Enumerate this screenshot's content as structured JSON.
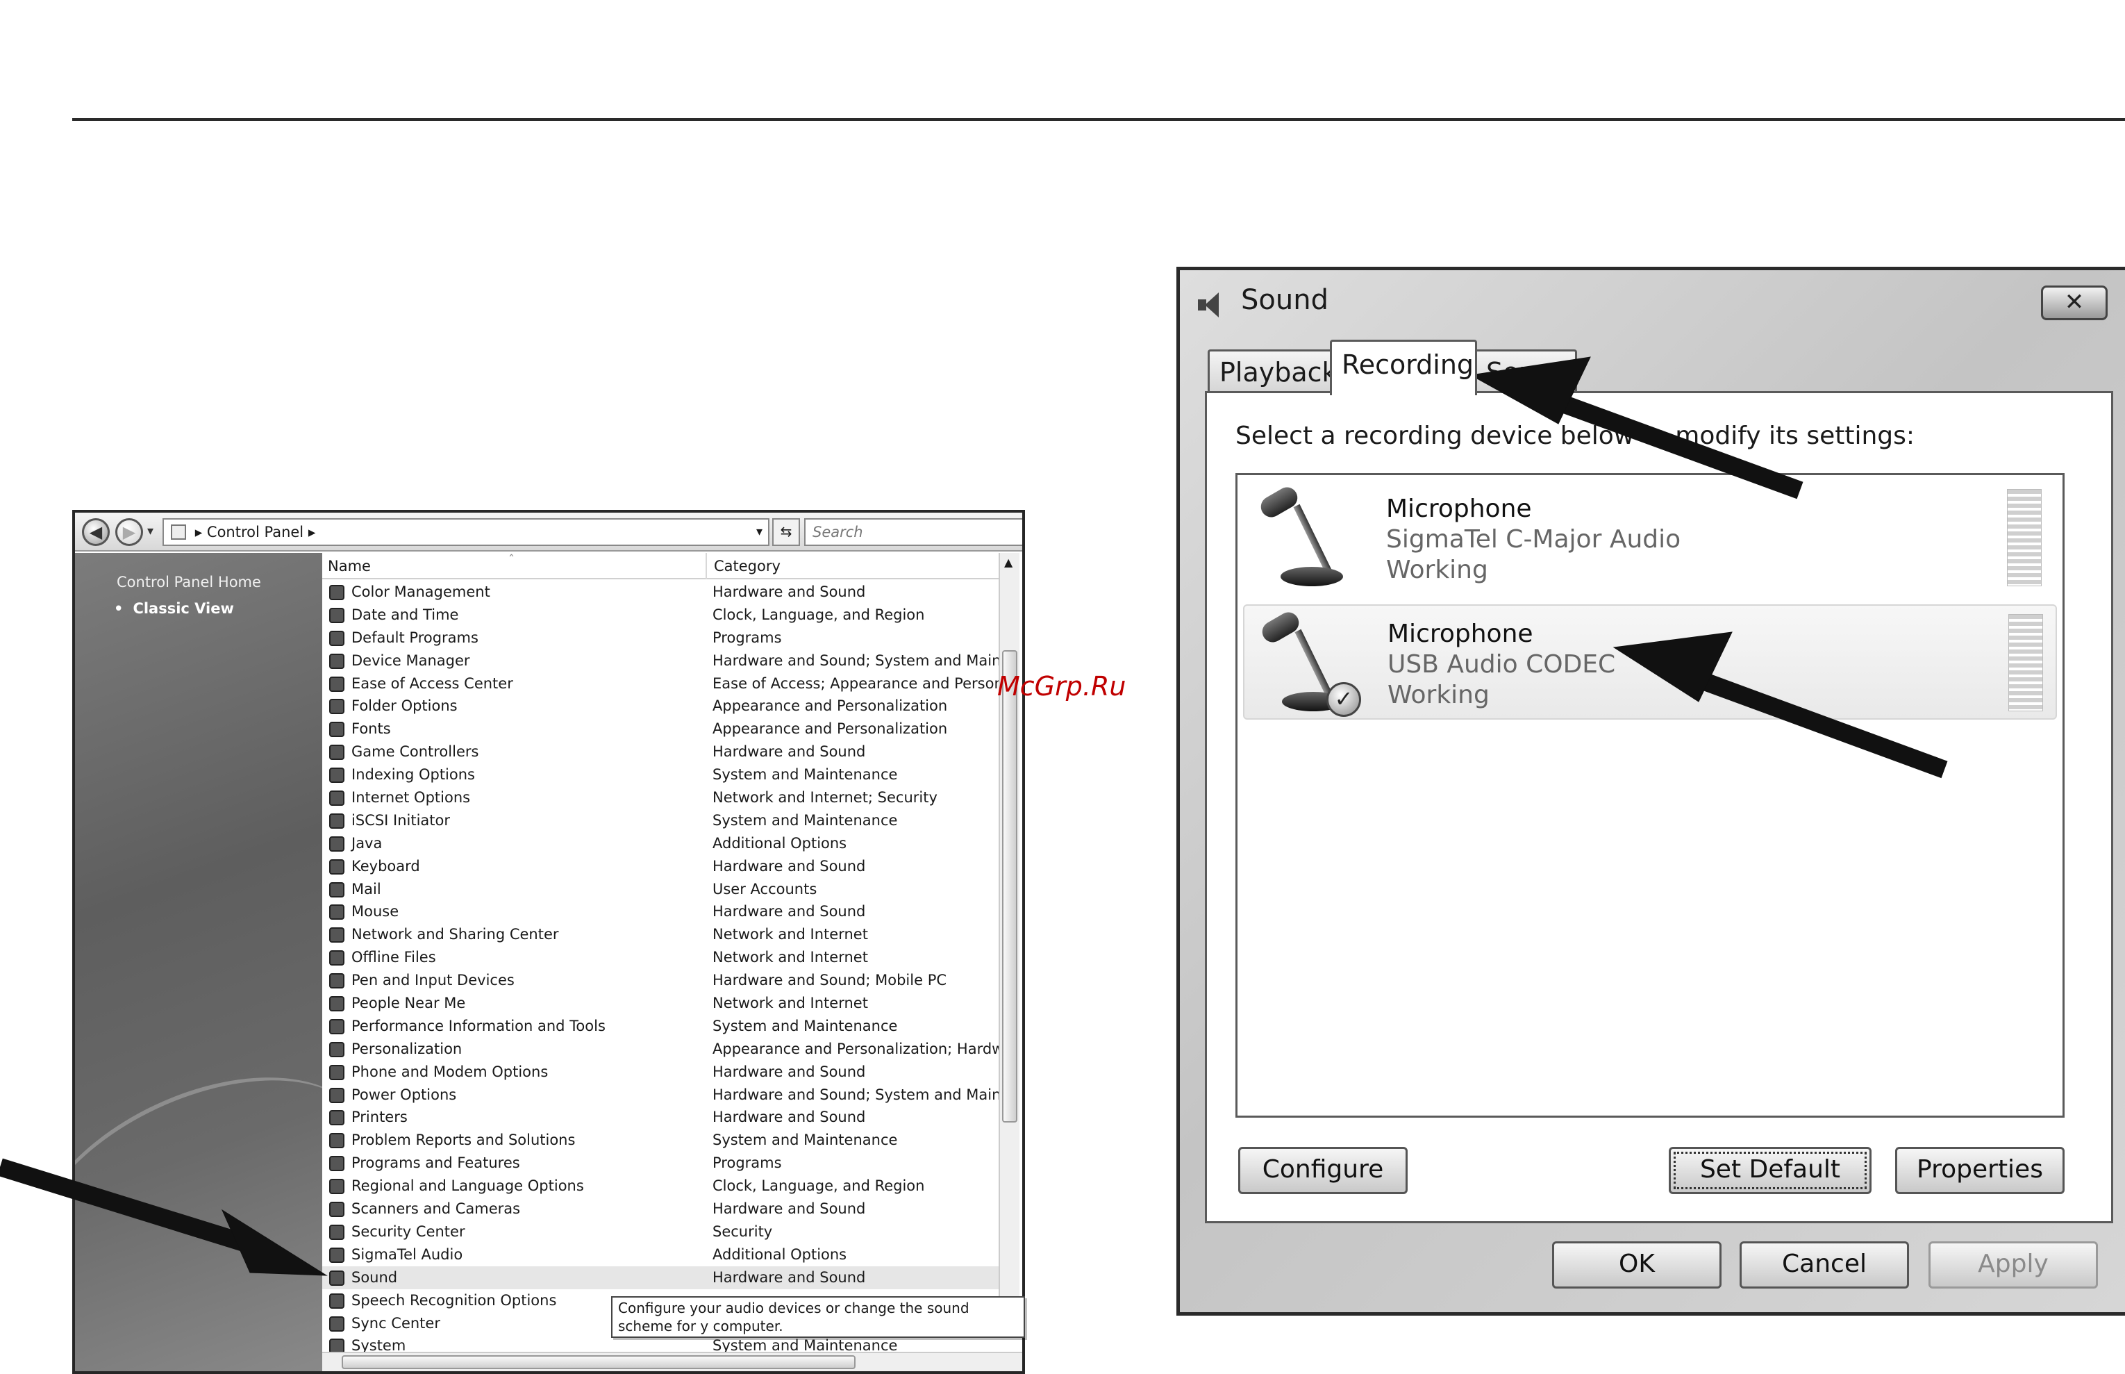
{
  "control_panel": {
    "address": "Control Panel",
    "search_placeholder": "Search",
    "sidebar": {
      "home": "Control Panel Home",
      "classic": "Classic View"
    },
    "columns": {
      "name": "Name",
      "category": "Category"
    },
    "items": [
      {
        "name": "Color Management",
        "category": "Hardware and Sound"
      },
      {
        "name": "Date and Time",
        "category": "Clock, Language, and Region"
      },
      {
        "name": "Default Programs",
        "category": "Programs"
      },
      {
        "name": "Device Manager",
        "category": "Hardware and Sound; System and Maintenanc"
      },
      {
        "name": "Ease of Access Center",
        "category": "Ease of Access; Appearance and Personalizatio"
      },
      {
        "name": "Folder Options",
        "category": "Appearance and Personalization"
      },
      {
        "name": "Fonts",
        "category": "Appearance and Personalization"
      },
      {
        "name": "Game Controllers",
        "category": "Hardware and Sound"
      },
      {
        "name": "Indexing Options",
        "category": "System and Maintenance"
      },
      {
        "name": "Internet Options",
        "category": "Network and Internet; Security"
      },
      {
        "name": "iSCSI Initiator",
        "category": "System and Maintenance"
      },
      {
        "name": "Java",
        "category": "Additional Options"
      },
      {
        "name": "Keyboard",
        "category": "Hardware and Sound"
      },
      {
        "name": "Mail",
        "category": "User Accounts"
      },
      {
        "name": "Mouse",
        "category": "Hardware and Sound"
      },
      {
        "name": "Network and Sharing Center",
        "category": "Network and Internet"
      },
      {
        "name": "Offline Files",
        "category": "Network and Internet"
      },
      {
        "name": "Pen and Input Devices",
        "category": "Hardware and Sound; Mobile PC"
      },
      {
        "name": "People Near Me",
        "category": "Network and Internet"
      },
      {
        "name": "Performance Information and Tools",
        "category": "System and Maintenance"
      },
      {
        "name": "Personalization",
        "category": "Appearance and Personalization; Hardware an"
      },
      {
        "name": "Phone and Modem Options",
        "category": "Hardware and Sound"
      },
      {
        "name": "Power Options",
        "category": "Hardware and Sound; System and Maintenanc"
      },
      {
        "name": "Printers",
        "category": "Hardware and Sound"
      },
      {
        "name": "Problem Reports and Solutions",
        "category": "System and Maintenance"
      },
      {
        "name": "Programs and Features",
        "category": "Programs"
      },
      {
        "name": "Regional and Language Options",
        "category": "Clock, Language, and Region"
      },
      {
        "name": "Scanners and Cameras",
        "category": "Hardware and Sound"
      },
      {
        "name": "Security Center",
        "category": "Security"
      },
      {
        "name": "SigmaTel Audio",
        "category": "Additional Options"
      },
      {
        "name": "Sound",
        "category": "Hardware and Sound"
      },
      {
        "name": "Speech Recognition Options",
        "category": ""
      },
      {
        "name": "Sync Center",
        "category": ""
      },
      {
        "name": "System",
        "category": "System and Maintenance"
      }
    ],
    "tooltip": "Configure your audio devices or change the sound scheme for y computer."
  },
  "watermark": "McGrp.Ru",
  "sound_dialog": {
    "title": "Sound",
    "close_label": "✕",
    "tabs": [
      "Playback",
      "Recording",
      "Sounds"
    ],
    "instruction": "Select a recording device below to modify its settings:",
    "devices": [
      {
        "name": "Microphone",
        "description": "SigmaTel C-Major Audio",
        "status": "Working"
      },
      {
        "name": "Microphone",
        "description": "USB Audio CODEC",
        "status": "Working"
      }
    ],
    "buttons": {
      "configure": "Configure",
      "set_default": "Set Default",
      "properties": "Properties",
      "ok": "OK",
      "cancel": "Cancel",
      "apply": "Apply"
    }
  }
}
